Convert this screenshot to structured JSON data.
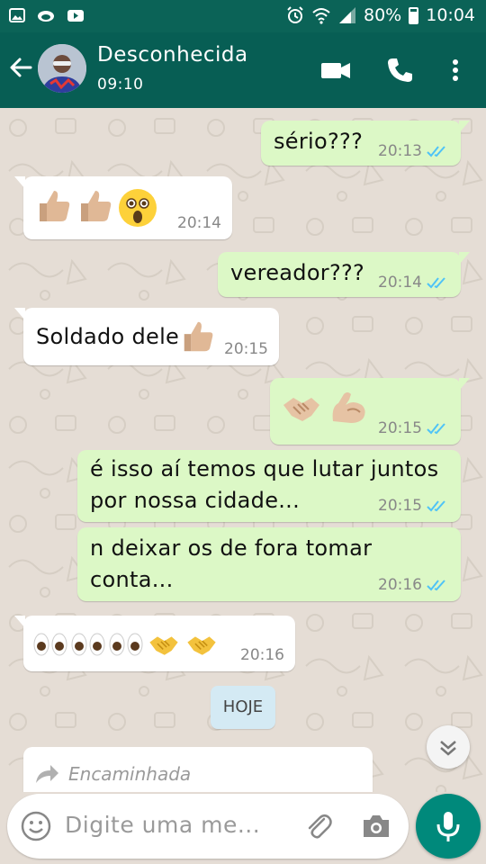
{
  "status_bar": {
    "battery": "80%",
    "time": "10:04"
  },
  "header": {
    "contact_name": "Desconhecida",
    "subtitle": "09:10"
  },
  "messages": [
    {
      "id": "m1",
      "direction": "out",
      "text": "sério???",
      "time": "20:13",
      "read": true
    },
    {
      "id": "m2",
      "direction": "in",
      "emojis": [
        "thumbs-up",
        "thumbs-up",
        "astonished-face"
      ],
      "time": "20:14"
    },
    {
      "id": "m3",
      "direction": "out",
      "text": "vereador???",
      "time": "20:14",
      "read": true
    },
    {
      "id": "m4",
      "direction": "in",
      "text": "Soldado dele",
      "emojis": [
        "thumbs-up"
      ],
      "time": "20:15"
    },
    {
      "id": "m5",
      "direction": "out",
      "emojis": [
        "handshake",
        "flexed-biceps"
      ],
      "time": "20:15",
      "read": true
    },
    {
      "id": "m6",
      "direction": "out",
      "text_lines": [
        "é  isso aí temos que lutar juntos",
        "por nossa cidade..."
      ],
      "time": "20:15",
      "read": true
    },
    {
      "id": "m7",
      "direction": "out",
      "text_lines": [
        "n deixar os de fora tomar",
        "conta..."
      ],
      "time": "20:16",
      "read": true
    },
    {
      "id": "m8",
      "direction": "in",
      "emojis": [
        "eyes",
        "eyes",
        "eyes",
        "handshake",
        "handshake"
      ],
      "time": "20:16"
    }
  ],
  "day_chip": "HOJE",
  "forwarded_label": "Encaminhada",
  "input": {
    "placeholder": "Digite uma me..."
  },
  "icons": {
    "status_left": [
      "image-icon",
      "cloud-icon",
      "youtube-icon"
    ],
    "status_right": [
      "alarm-icon",
      "wifi-icon",
      "signal-icon",
      "battery-icon"
    ],
    "appbar": [
      "back-arrow-icon",
      "video-call-icon",
      "phone-icon",
      "more-vert-icon"
    ],
    "input": [
      "emoji-icon",
      "attach-icon",
      "camera-icon",
      "mic-icon"
    ],
    "chat": [
      "scroll-down-icon",
      "forward-icon"
    ]
  },
  "colors": {
    "status_bar": "#0b6357",
    "app_bar": "#075e54",
    "outgoing_bubble": "#dcf8c6",
    "incoming_bubble": "#ffffff",
    "read_ticks": "#4fc3f7",
    "mic_button": "#00897b",
    "day_chip": "#d4eaf4"
  }
}
